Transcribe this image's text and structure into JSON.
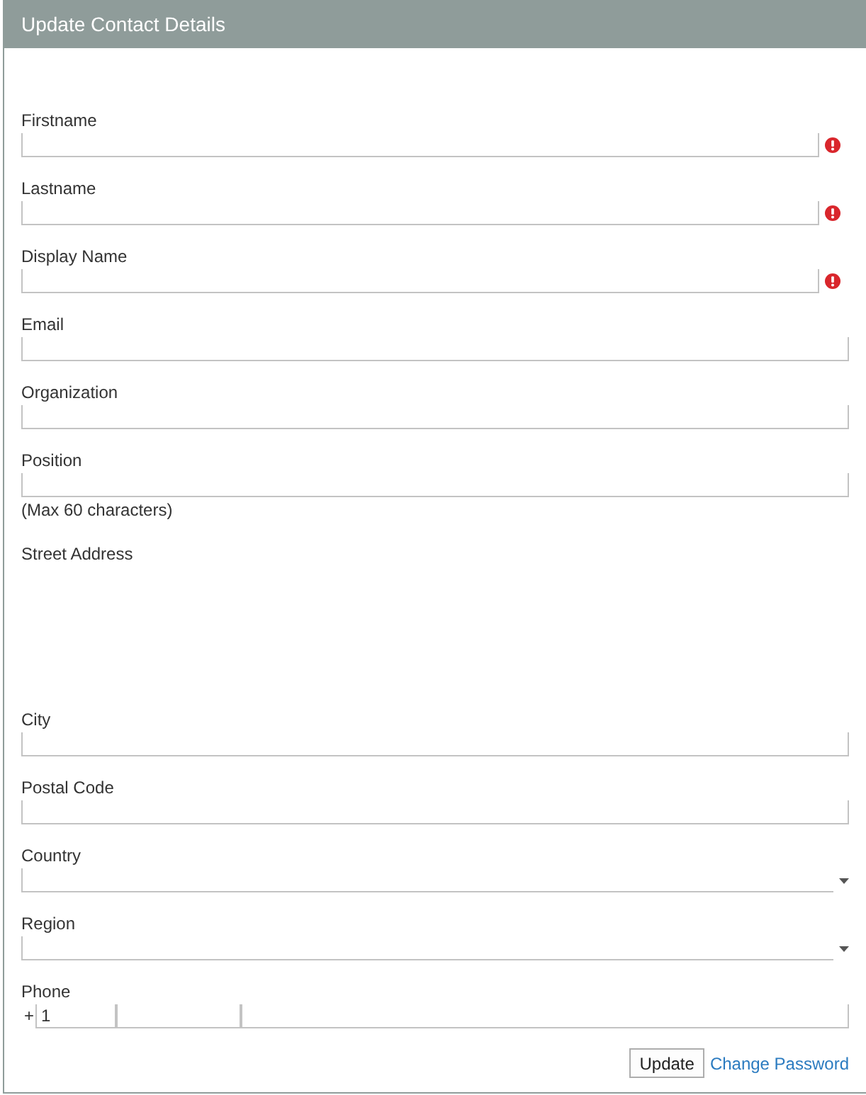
{
  "window": {
    "title": "Update Contact Details"
  },
  "fields": [
    {
      "label": "Firstname",
      "kind": "text",
      "invalid": true
    },
    {
      "label": "Lastname",
      "kind": "text",
      "invalid": true
    },
    {
      "label": "Display Name",
      "kind": "text",
      "invalid": true
    },
    {
      "label": "Email",
      "kind": "text",
      "invalid": false
    },
    {
      "label": "Organization",
      "kind": "text",
      "invalid": false
    },
    {
      "label": "Position",
      "kind": "text",
      "invalid": false,
      "note": "(Max 60 characters)"
    },
    {
      "label": "Street Address",
      "kind": "textarea",
      "invalid": false
    },
    {
      "label": "City",
      "kind": "text",
      "invalid": false
    },
    {
      "label": "Postal Code",
      "kind": "text",
      "invalid": false
    },
    {
      "label": "Country",
      "kind": "select",
      "invalid": false
    },
    {
      "label": "Region",
      "kind": "select",
      "invalid": false
    },
    {
      "label": "Phone",
      "kind": "phone",
      "invalid": false,
      "prefix": "+",
      "country_code": "1"
    }
  ],
  "actions": [
    {
      "kind": "button",
      "label": "Update"
    },
    {
      "kind": "link",
      "label": "Change Password"
    }
  ]
}
